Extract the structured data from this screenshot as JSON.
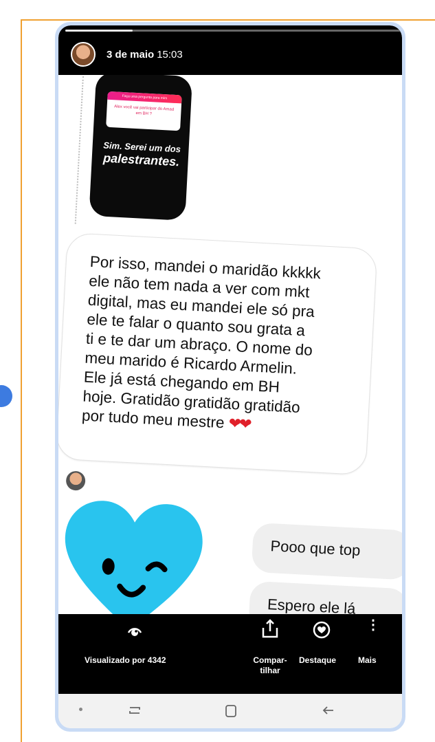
{
  "story": {
    "progress": 0.2,
    "date": "3 de maio",
    "time": "15:03"
  },
  "shared_card": {
    "poll_header": "Faça uma pergunta para mim",
    "poll_question": "Alex você vai participar do Amad em BH ?",
    "answer_line1": "Sim. Serei um dos",
    "answer_line2": "palestrantes."
  },
  "message": {
    "text": "Por isso, mandei o maridão kkkkk\nele não tem nada a ver com mkt\ndigital, mas eu mandei ele só pra\nele te falar o quanto sou grata a\nti e te dar um abraço.  O nome do\nmeu marido é Ricardo Armelin.\nEle já  está chegando em BH\nhoje. Gratidão gratidão gratidão\npor tudo meu mestre ",
    "emoji": "❤❤"
  },
  "reaction": {
    "emoji": "❤"
  },
  "replies": [
    {
      "text": "Pooo que top"
    },
    {
      "text": "Espero ele lá"
    }
  ],
  "actions": {
    "seen_label": "Visualizado por 4342",
    "share_label": "Compar-\ntilhar",
    "highlight_label": "Destaque",
    "more_label": "Mais",
    "more_icon": "⋮"
  },
  "colors": {
    "frame": "#f0a030",
    "phone_border": "#c9dbf5",
    "heart": "#e0202a",
    "sticker_heart": "#29c4ee"
  }
}
